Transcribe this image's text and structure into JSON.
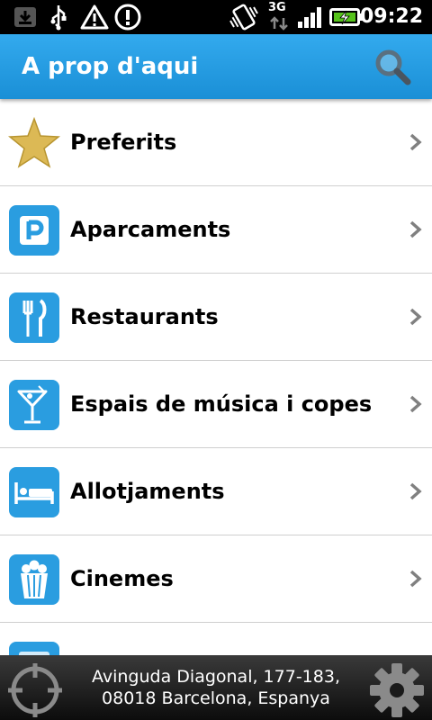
{
  "status_bar": {
    "time": "09:22",
    "network": "3G",
    "icons": [
      "download-icon",
      "usb-icon",
      "warning-icon",
      "alert-icon",
      "vibrate-icon",
      "signal-icon",
      "battery-charging-icon"
    ]
  },
  "app_bar": {
    "title": "A prop d'aqui",
    "search_icon": "search-icon"
  },
  "categories": [
    {
      "label": "Preferits",
      "icon": "star-icon"
    },
    {
      "label": "Aparcaments",
      "icon": "parking-icon"
    },
    {
      "label": "Restaurants",
      "icon": "fork-knife-icon"
    },
    {
      "label": "Espais de música i copes",
      "icon": "cocktail-icon"
    },
    {
      "label": "Allotjaments",
      "icon": "bed-icon"
    },
    {
      "label": "Cinemes",
      "icon": "popcorn-icon"
    },
    {
      "label": "",
      "icon": "category-icon"
    }
  ],
  "footer": {
    "address_line1": "Avinguda Diagonal, 177-183,",
    "address_line2": "08018 Barcelona, Espanya",
    "location_icon": "crosshair-icon",
    "settings_icon": "gear-icon"
  },
  "colors": {
    "accent": "#1a8fd6",
    "icon_blue": "#2a9de0",
    "star_gold": "#d8b24a"
  }
}
